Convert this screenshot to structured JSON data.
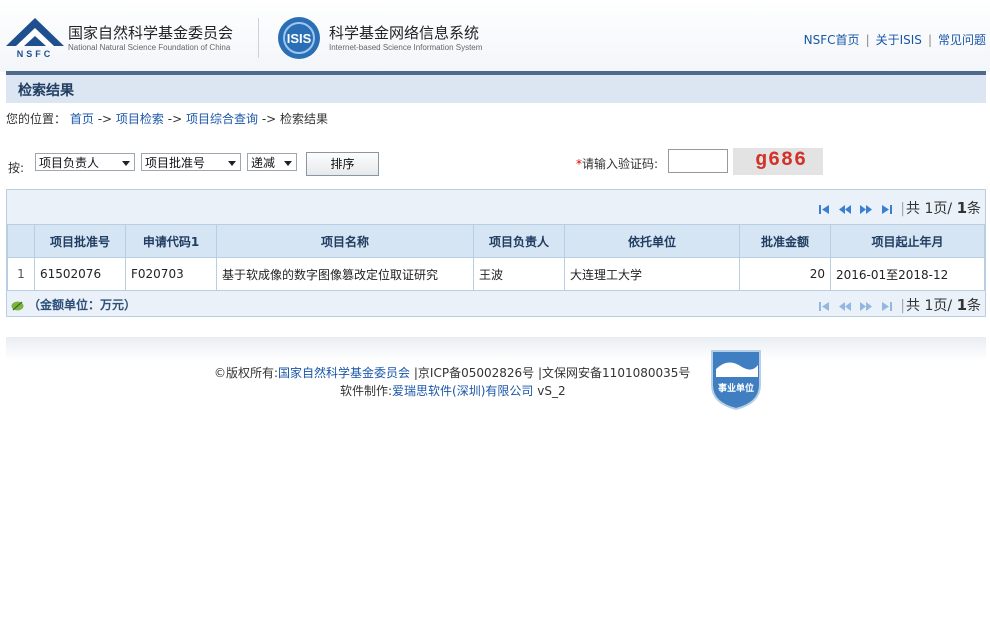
{
  "header": {
    "org_name_cn": "国家自然科学基金委员会",
    "org_name_en": "National Natural Science Foundation of China",
    "logo_text": "NSFC",
    "system_logo_text": "ISIS",
    "system_name_cn": "科学基金网络信息系统",
    "system_name_en": "Internet-based Science Information System",
    "links": [
      "NSFC首页",
      "关于ISIS",
      "常见问题"
    ]
  },
  "page_title": "检索结果",
  "breadcrumb": {
    "prefix": "您的位置：",
    "items": [
      "首页",
      "项目检索",
      "项目综合查询"
    ],
    "arrow": "->",
    "current": "检索结果"
  },
  "form": {
    "sort_by_label": "按:",
    "field_select": "项目负责人",
    "field_select2": "项目批准号",
    "order_select": "递减",
    "sort_button": "排序",
    "captcha_required_mark": "*",
    "captcha_label": "请输入验证码:",
    "captcha_input_value": "",
    "captcha_image_text": "g686"
  },
  "pager": {
    "text_total": "共",
    "pages": "1",
    "text_pages_unit": "页/",
    "records": "1",
    "text_records_unit": "条"
  },
  "table": {
    "columns": [
      "",
      "项目批准号",
      "申请代码1",
      "项目名称",
      "项目负责人",
      "依托单位",
      "批准金额",
      "项目起止年月"
    ],
    "rows": [
      {
        "no": "1",
        "approval_no": "61502076",
        "code": "F020703",
        "name": "基于软成像的数字图像篡改定位取证研究",
        "leader": "王波",
        "institution": "大连理工大学",
        "amount": "20",
        "period": "2016-01至2018-12"
      }
    ]
  },
  "unit_note": "（金额单位：万元）",
  "footer": {
    "copyright_prefix": "©版权所有:",
    "copyright_org": "国家自然科学基金委员会",
    "icp": "|京ICP备05002826号",
    "police": "|文保网安备1101080035号",
    "software_prefix": "软件制作:",
    "software_company": "爱瑞思软件(深圳)有限公司",
    "version": "vS_2",
    "badge_text": "事业单位"
  },
  "colors": {
    "link": "#1a56a8",
    "title_bg": "#dbe6f2",
    "header_bar": "#4d6a8c",
    "table_header_bg": "#d5e5f4",
    "captcha_text": "#d1332b"
  }
}
